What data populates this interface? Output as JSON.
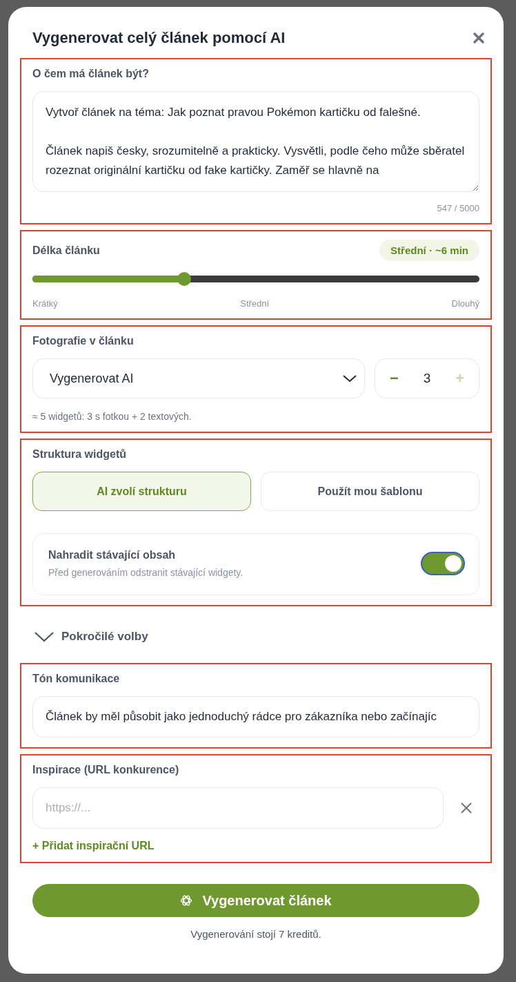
{
  "dialog": {
    "title": "Vygenerovat celý článek pomocí AI"
  },
  "prompt": {
    "label": "O čem má článek být?",
    "value": "Vytvoř článek na téma: Jak poznat pravou Pokémon kartičku od falešné.\n\nČlánek napiš česky, srozumitelně a prakticky. Vysvětli, podle čeho může sběratel rozeznat originální kartičku od fake kartičky. Zaměř se hlavně na",
    "counter": "547 / 5000"
  },
  "length": {
    "label": "Délka článku",
    "badge": "Střední · ~6 min",
    "level": 0.34,
    "ticks": [
      "Krátký",
      "Střední",
      "Dlouhý"
    ]
  },
  "photos": {
    "label": "Fotografie v článku",
    "select_value": "Vygenerovat AI",
    "decrement": {
      "symbol": "−",
      "disabled": false
    },
    "count": "3",
    "increment": {
      "symbol": "+",
      "disabled": true
    },
    "hint": "≈ 5 widgetů: 3 s fotkou + 2 textových."
  },
  "structure": {
    "label": "Struktura widgetů",
    "options": [
      {
        "label": "AI zvolí strukturu",
        "selected": true
      },
      {
        "label": "Použít mou šablonu",
        "selected": false
      }
    ],
    "replace": {
      "title": "Nahradit stávající obsah",
      "description": "Před generováním odstranit stávající widgety.",
      "on": true
    }
  },
  "advanced": {
    "label": "Pokročilé volby",
    "expanded": false
  },
  "tone": {
    "label": "Tón komunikace",
    "value": "Článek by měl působit jako jednoduchý rádce pro zákazníka nebo začínajíc"
  },
  "inspiration": {
    "label": "Inspirace (URL konkurence)",
    "placeholder": "https://...",
    "add_link": "+ Přidat inspirační URL"
  },
  "submit": {
    "label": "Vygenerovat článek"
  },
  "cost_note": "Vygenerování stojí 7 kreditů."
}
